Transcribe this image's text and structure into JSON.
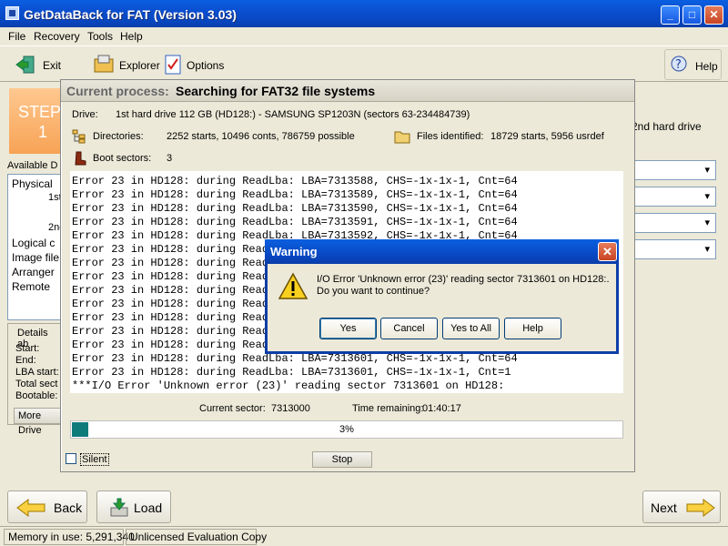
{
  "window": {
    "title": "GetDataBack for FAT (Version 3.03)",
    "controls": {
      "minimize": "_",
      "maximize": "□",
      "close": "✕"
    }
  },
  "menu": [
    "File",
    "Recovery",
    "Tools",
    "Help"
  ],
  "toolbar": {
    "exit_label": "Exit",
    "explorer_label": "Explorer",
    "options_label": "Options",
    "help_label": "Help"
  },
  "left": {
    "step_title": "STEP",
    "step_number": "1",
    "available_drives": "Available D",
    "tree": [
      "Physical",
      "1st",
      "2nd",
      "Logical c",
      "Image file",
      "Arranger",
      "Remote"
    ],
    "details_label": "Details ab",
    "details_fields": [
      "Start:",
      "End:",
      "LBA start:",
      "Total sect",
      "Bootable:"
    ],
    "more_drives": "More Drive"
  },
  "right": {
    "second_drive": "2nd hard drive"
  },
  "process": {
    "label": "Current process:",
    "value": "Searching for FAT32 file systems",
    "drive_label": "Drive:",
    "drive_value": "1st hard drive 112 GB (HD128:) - SAMSUNG SP1203N (sectors 63-234484739)",
    "directories_label": "Directories:",
    "directories_value": "2252 starts, 10496 conts, 786759 possible",
    "files_label": "Files identified:",
    "files_value": "18729 starts, 5956 usrdef",
    "boot_label": "Boot sectors:",
    "boot_value": "3",
    "log": [
      "Error 23 in HD128: during ReadLba: LBA=7313588, CHS=-1x-1x-1, Cnt=64",
      "Error 23 in HD128: during ReadLba: LBA=7313589, CHS=-1x-1x-1, Cnt=64",
      "Error 23 in HD128: during ReadLba: LBA=7313590, CHS=-1x-1x-1, Cnt=64",
      "Error 23 in HD128: during ReadLba: LBA=7313591, CHS=-1x-1x-1, Cnt=64",
      "Error 23 in HD128: during ReadLba: LBA=7313592, CHS=-1x-1x-1, Cnt=64",
      "Error 23 in HD128: during ReadLba: LBA=7313593, CHS=-1x-1x-1, Cnt=64",
      "Error 23 in HD128: during ReadLba: LBA=7313594, CHS=-1x-1x-1, Cnt=64",
      "Error 23 in HD128: during ReadLba: LBA=7313595, CHS=-1x-1x-1, Cnt=64",
      "Error 23 in HD128: during ReadLba: LBA=7313596, CHS=-1x-1x-1, Cnt=64",
      "Error 23 in HD128: during ReadLba: LBA=7313597, CHS=-1x-1x-1, Cnt=64",
      "Error 23 in HD128: during ReadLba: LBA=7313598, CHS=-1x-1x-1, Cnt=64",
      "Error 23 in HD128: during ReadLba: LBA=7313599, CHS=-1x-1x-1, Cnt=64",
      "Error 23 in HD128: during ReadLba: LBA=7313600, CHS=-1x-1x-1, Cnt=64",
      "Error 23 in HD128: during ReadLba: LBA=7313601, CHS=-1x-1x-1, Cnt=64",
      "Error 23 in HD128: during ReadLba: LBA=7313601, CHS=-1x-1x-1, Cnt=1",
      "***I/O Error 'Unknown error (23)' reading sector 7313601 on HD128:"
    ],
    "current_sector_label": "Current sector:",
    "current_sector_value": "7313000",
    "time_label": "Time remaining:",
    "time_value": "01:40:17",
    "progress_percent": 3,
    "progress_text": "3%",
    "silent_label": "Silent",
    "stop_label": "Stop"
  },
  "warning": {
    "title": "Warning",
    "line1": "I/O Error 'Unknown error (23)' reading sector 7313601 on HD128:.",
    "line2": "Do you want to continue?",
    "buttons": {
      "yes": "Yes",
      "no": "Cancel",
      "yes_all": "Yes to All",
      "help": "Help"
    }
  },
  "nav": {
    "back": "Back",
    "load": "Load",
    "next": "Next"
  },
  "status": {
    "memory": "Memory in use: 5,291,340",
    "license": "Unlicensed Evaluation Copy"
  }
}
